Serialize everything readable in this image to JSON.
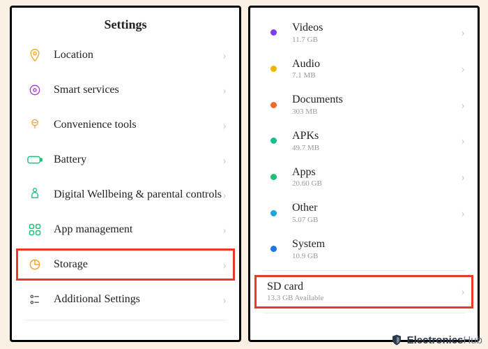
{
  "left": {
    "title": "Settings",
    "items": [
      {
        "label": "Location",
        "icon": "location",
        "color": "#f5a623"
      },
      {
        "label": "Smart services",
        "icon": "smart",
        "color": "#a63ad6"
      },
      {
        "label": "Convenience tools",
        "icon": "convenience",
        "color": "#f5a623"
      },
      {
        "label": "Battery",
        "icon": "battery",
        "color": "#1fbf7a"
      },
      {
        "label": "Digital Wellbeing & parental controls",
        "icon": "wellbeing",
        "color": "#1fbf7a"
      },
      {
        "label": "App management",
        "icon": "apps",
        "color": "#1fbf7a"
      },
      {
        "label": "Storage",
        "icon": "storage",
        "color": "#f5a623",
        "highlighted": true
      },
      {
        "label": "Additional Settings",
        "icon": "additional",
        "color": "#555"
      }
    ]
  },
  "right": {
    "categories": [
      {
        "label": "Videos",
        "sub": "11.7 GB",
        "dot": "#7a3ff0"
      },
      {
        "label": "Audio",
        "sub": "7.1 MB",
        "dot": "#f0b400"
      },
      {
        "label": "Documents",
        "sub": "303 MB",
        "dot": "#ef6a2a"
      },
      {
        "label": "APKs",
        "sub": "49.7 MB",
        "dot": "#16c08a"
      },
      {
        "label": "Apps",
        "sub": "20.60 GB",
        "dot": "#1fbf7a"
      },
      {
        "label": "Other",
        "sub": "5.07 GB",
        "dot": "#1aa8e0"
      },
      {
        "label": "System",
        "sub": "10.9 GB",
        "dot": "#1a78e0"
      }
    ],
    "sd": {
      "label": "SD card",
      "sub": "13.3 GB Available",
      "highlighted": true
    }
  },
  "watermark": {
    "brand": "Electronics",
    "suffix": "Hub"
  }
}
